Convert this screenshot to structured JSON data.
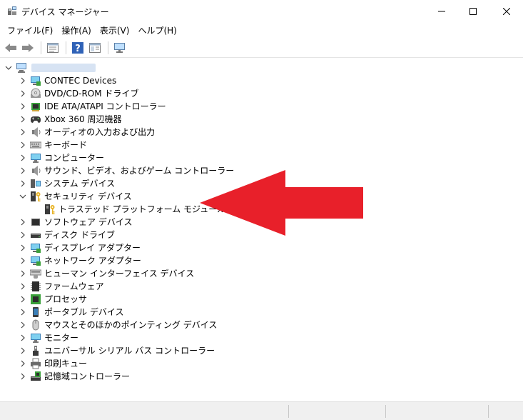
{
  "window": {
    "title": "デバイス マネージャー"
  },
  "menu": [
    {
      "label": "ファイル(F)"
    },
    {
      "label": "操作(A)"
    },
    {
      "label": "表示(V)"
    },
    {
      "label": "ヘルプ(H)"
    }
  ],
  "toolbar": [
    {
      "icon": "back-arrow-icon"
    },
    {
      "icon": "forward-arrow-icon"
    },
    {
      "icon": "properties-icon"
    },
    {
      "icon": "help-icon"
    },
    {
      "icon": "show-hide-icon"
    },
    {
      "icon": "monitor-scan-icon"
    }
  ],
  "tree": {
    "root": {
      "icon": "computer-icon",
      "expanded": true
    },
    "items": [
      {
        "label": "CONTEC Devices",
        "icon": "contec-device-icon",
        "expanded": false
      },
      {
        "label": "DVD/CD-ROM ドライブ",
        "icon": "dvd-drive-icon",
        "expanded": false
      },
      {
        "label": "IDE ATA/ATAPI コントローラー",
        "icon": "ide-controller-icon",
        "expanded": false
      },
      {
        "label": "Xbox 360 周辺機器",
        "icon": "gamepad-icon",
        "expanded": false
      },
      {
        "label": "オーディオの入力および出力",
        "icon": "speaker-icon",
        "expanded": false
      },
      {
        "label": "キーボード",
        "icon": "keyboard-icon",
        "expanded": false
      },
      {
        "label": "コンピューター",
        "icon": "monitor-icon",
        "expanded": false
      },
      {
        "label": "サウンド、ビデオ、およびゲーム コントローラー",
        "icon": "speaker-icon",
        "expanded": false
      },
      {
        "label": "システム デバイス",
        "icon": "system-device-icon",
        "expanded": false
      },
      {
        "label": "セキュリティ デバイス",
        "icon": "security-key-icon",
        "expanded": true,
        "children": [
          {
            "label": "トラステッド プラットフォーム モジュール 2.0",
            "icon": "security-key-icon"
          }
        ]
      },
      {
        "label": "ソフトウェア デバイス",
        "icon": "software-device-icon",
        "expanded": false
      },
      {
        "label": "ディスク ドライブ",
        "icon": "disk-drive-icon",
        "expanded": false
      },
      {
        "label": "ディスプレイ アダプター",
        "icon": "display-adapter-icon",
        "expanded": false
      },
      {
        "label": "ネットワーク アダプター",
        "icon": "network-adapter-icon",
        "expanded": false
      },
      {
        "label": "ヒューマン インターフェイス デバイス",
        "icon": "hid-icon",
        "expanded": false
      },
      {
        "label": "ファームウェア",
        "icon": "firmware-icon",
        "expanded": false
      },
      {
        "label": "プロセッサ",
        "icon": "processor-icon",
        "expanded": false
      },
      {
        "label": "ポータブル デバイス",
        "icon": "portable-device-icon",
        "expanded": false
      },
      {
        "label": "マウスとそのほかのポインティング デバイス",
        "icon": "mouse-icon",
        "expanded": false
      },
      {
        "label": "モニター",
        "icon": "monitor-icon",
        "expanded": false
      },
      {
        "label": "ユニバーサル シリアル バス コントローラー",
        "icon": "usb-icon",
        "expanded": false
      },
      {
        "label": "印刷キュー",
        "icon": "printer-icon",
        "expanded": false
      },
      {
        "label": "記憶域コントローラー",
        "icon": "storage-controller-icon",
        "expanded": false
      }
    ]
  },
  "annotation": {
    "icon": "red-arrow-icon",
    "color": "#e8202a"
  }
}
